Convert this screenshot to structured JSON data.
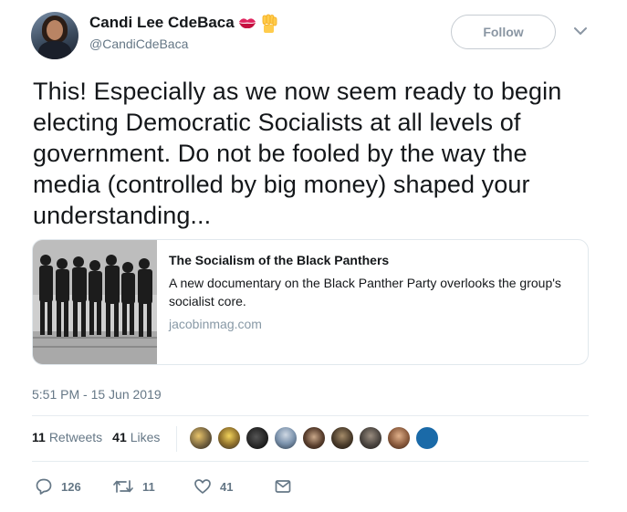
{
  "author": {
    "display_name": "Candi Lee CdeBaca",
    "handle": "@CandiCdeBaca",
    "emojis": [
      "kiss-mark-emoji",
      "raised-fist-emoji"
    ]
  },
  "header": {
    "follow_label": "Follow"
  },
  "tweet": {
    "text": "This! Especially as we now seem ready to begin electing Democratic Socialists at all levels of government. Do not be fooled by the way the media (controlled by big money) shaped your understanding...",
    "timestamp": "5:51 PM - 15 Jun 2019"
  },
  "card": {
    "title": "The Socialism of the Black Panthers",
    "description": "A new documentary on the Black Panther Party overlooks the group's socialist core.",
    "domain": "jacobinmag.com"
  },
  "stats": {
    "retweets_count": "11",
    "retweets_label": "Retweets",
    "likes_count": "41",
    "likes_label": "Likes"
  },
  "actions": {
    "reply_count": "126",
    "retweet_count": "11",
    "like_count": "41"
  },
  "colors": {
    "text": "#14171a",
    "secondary": "#657786",
    "border": "#e1e8ed",
    "follow_border": "#c6ccd2"
  }
}
